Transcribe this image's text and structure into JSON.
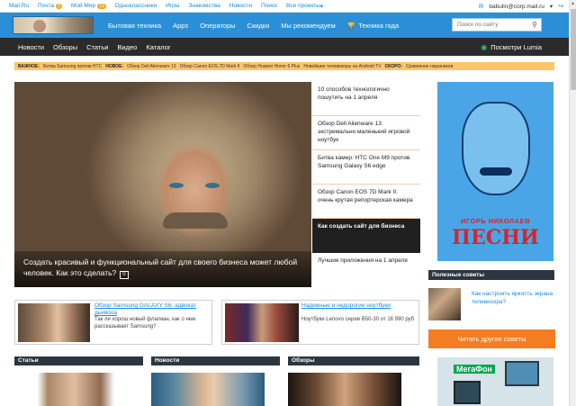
{
  "topbar": {
    "links": [
      "Mail.Ru",
      "Почта",
      "Мой Мир",
      "Одноклассники",
      "Игры",
      "Знакомства",
      "Новости",
      "Поиск",
      "Все проекты"
    ],
    "mail_count": "3",
    "myworld_count": "13",
    "user_email": "babulin@corp.mail.ru",
    "dropdown_icon": "chevron-down-icon",
    "logout_icon": "logout-icon"
  },
  "header": {
    "nav": [
      "Бытовая техника",
      "Apps",
      "Операторы",
      "Скидки",
      "Мы рекомендуем",
      "Техника года"
    ],
    "trophy_icon": "trophy-icon",
    "search_placeholder": "Поиск по сайту"
  },
  "subnav": {
    "items": [
      "Новости",
      "Обзоры",
      "Статьи",
      "Видео",
      "Каталог"
    ],
    "lumia_label": "Посмотри Lumia"
  },
  "ticker": {
    "important_label": "ВАЖНОЕ:",
    "important_text": "Битва Samsung против HTC",
    "new_label": "НОВОЕ:",
    "new_items": [
      "Обзор Dell Alienware 13",
      "Обзор Canon EOS 7D Mark II",
      "Обзор Huawei Honor 6 Plus",
      "Новейшие телевизоры на Android TV"
    ],
    "soon_label": "СКОРО:",
    "soon_text": "Сравнение наушников"
  },
  "hero": {
    "caption": "Создать красивый и функциональный сайт для своего бизнеса может любой человек. Как это сделать?",
    "badge": "0"
  },
  "hero_list": [
    "10 способов технологично пошутить на 1 апреля",
    "Обзор Dell Alienware 13: экстремально маленький игровой ноутбук",
    "Битва камер: HTC One M9 против Samsung Galaxy S6 edge",
    "Обзор Canon EOS 7D Mark II: очень крутая репортерская камера",
    "Как создать сайт для бизнеса",
    "Лучшие приложения на 1 апреля"
  ],
  "poster": {
    "line1": "ИГОРЬ НИКОЛАЕВ",
    "line2": "ПЕСНИ"
  },
  "tips": {
    "heading": "Полезные советы",
    "item": "Как настроить яркость экрана телевизора?",
    "more_button": "Читать другие советы"
  },
  "ad": {
    "brand": "МегаФон"
  },
  "cards": [
    {
      "title": "Обзор Samsung GALAXY S6: адвокат дьявола",
      "text": "Так ли хорош новый флагман, как о нем рассказывает Samsung?"
    },
    {
      "title": "Надежные и недорогие ноутбуки",
      "text": "Ноутбуки Lenovo серии B50-30 от 16 990 руб"
    }
  ],
  "sections": [
    "Статьи",
    "Новости",
    "Обзоры"
  ]
}
